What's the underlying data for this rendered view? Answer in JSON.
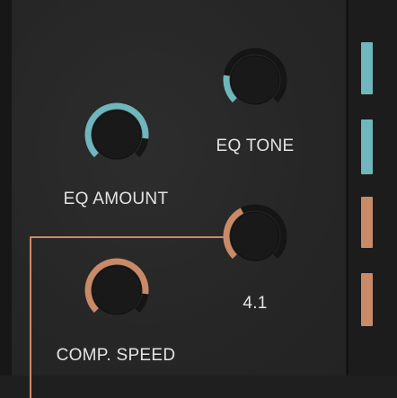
{
  "colors": {
    "accent_teal": "#6fb6bd",
    "accent_copper": "#c98a68",
    "track": "#151515",
    "knob_body": "#191919"
  },
  "knobs": {
    "eq_amount": {
      "label": "EQ AMOUNT",
      "level": 0.86,
      "accent": "teal"
    },
    "eq_tone": {
      "label": "EQ TONE",
      "level": 0.2,
      "accent": "teal"
    },
    "comp_value": {
      "readout": "4.1",
      "level": 0.4,
      "accent": "copper"
    },
    "comp_speed": {
      "label": "COMP. SPEED",
      "level": 0.86,
      "accent": "copper"
    }
  },
  "meters": {
    "segments": [
      {
        "accent": "teal"
      },
      {
        "accent": "teal"
      },
      {
        "accent": "copper"
      },
      {
        "accent": "copper"
      }
    ]
  }
}
